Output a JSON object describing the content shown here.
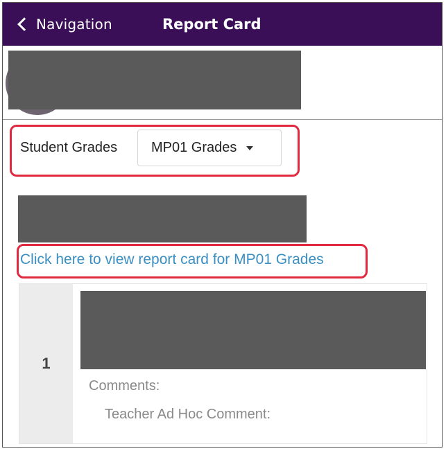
{
  "header": {
    "back_label": "Navigation",
    "title": "Report Card",
    "bar_color": "#3a0f57"
  },
  "grades": {
    "selector_label": "Student Grades",
    "selected_option": "MP01 Grades",
    "report_link": "Click here to view report card for MP01 Grades"
  },
  "card": {
    "number": "1",
    "comments_label": "Comments:",
    "teacher_comment_label": "Teacher Ad Hoc Comment:"
  },
  "colors": {
    "highlight": "#e0283f",
    "link": "#3a8fc2",
    "redaction": "#5a5a5a"
  }
}
